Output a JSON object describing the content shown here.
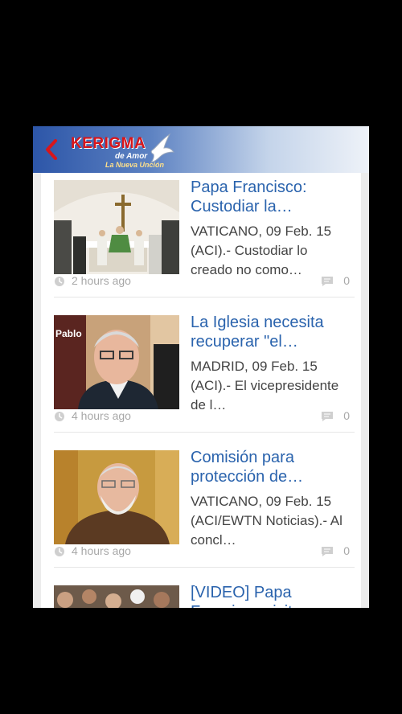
{
  "header": {
    "logo_title": "KERIGMA",
    "logo_line1": "de Amor",
    "logo_line2": "La Nueva Unción",
    "back_icon": "chevron-left-icon",
    "brand_color": "#d8161b"
  },
  "feed": {
    "items": [
      {
        "title": "Papa Francisco: Custodiar la…",
        "excerpt": "VATICANO, 09 Feb. 15 (ACI).- Custodiar lo creado no como…",
        "time": "2 hours ago",
        "comments": "0"
      },
      {
        "title": "La Iglesia necesita recuperar \"el…",
        "excerpt": "MADRID, 09 Feb. 15 (ACI).- El vicepresidente de l…",
        "time": "4 hours ago",
        "comments": "0",
        "thumb_caption": "Pablo"
      },
      {
        "title": "Comisión para protección de…",
        "excerpt": "VATICANO, 09 Feb. 15 (ACI/EWTN Noticias).- Al concl…",
        "time": "4 hours ago",
        "comments": "0"
      },
      {
        "title": "[VIDEO] Papa Francisco visita…",
        "excerpt": "",
        "time": "",
        "comments": ""
      }
    ]
  },
  "colors": {
    "title": "#2a63ad",
    "meta": "#a8a8a8"
  }
}
